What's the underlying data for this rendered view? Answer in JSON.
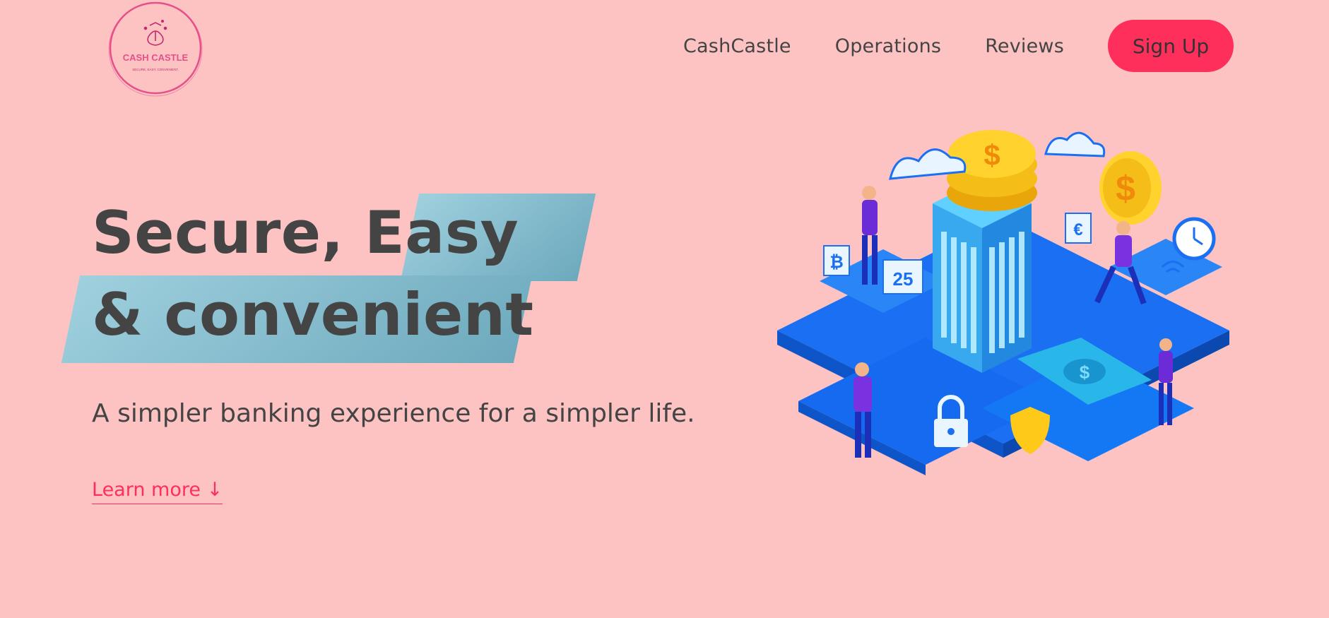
{
  "brand": {
    "logo_text": "CASH CASTLE",
    "logo_tagline": "SECURE, EASY, CONVENIENT."
  },
  "nav": {
    "links": [
      "CashCastle",
      "Operations",
      "Reviews"
    ],
    "signup_label": "Sign Up"
  },
  "hero": {
    "headline_part1": "Secure, ",
    "headline_highlight": "Easy",
    "headline_line2": "& convenient",
    "tagline": "A simpler banking experience for a simpler life.",
    "learn_more": "Learn more ↓"
  },
  "illustration": {
    "calendar_number": "25"
  },
  "colors": {
    "background": "#fdc3c3",
    "accent": "#ff2f5c",
    "highlight": "#8cc4d4",
    "text": "#444444"
  }
}
